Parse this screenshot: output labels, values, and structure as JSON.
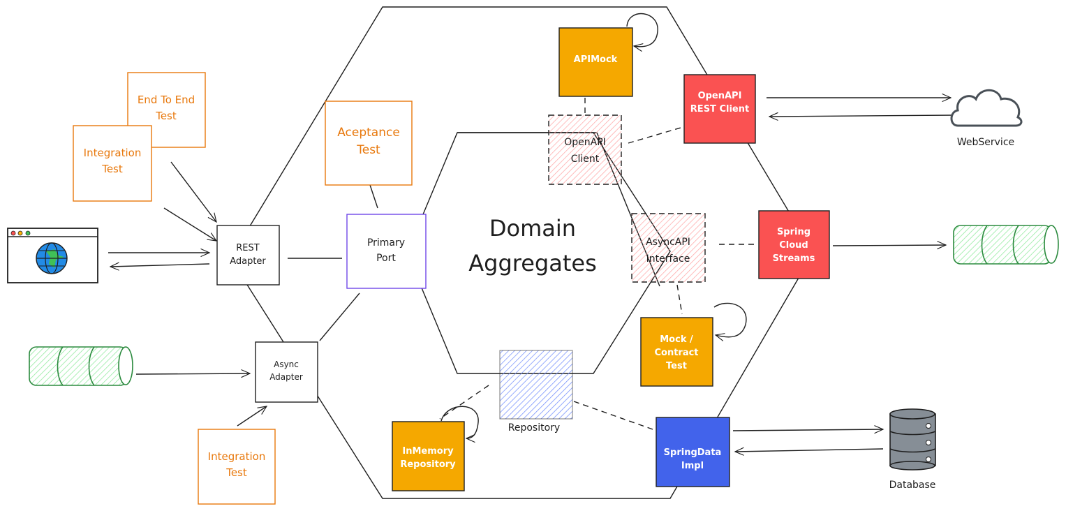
{
  "title": [
    "Domain",
    "Aggregates"
  ],
  "tests": {
    "end_to_end": [
      "End To End",
      "Test"
    ],
    "integration_top": [
      "Integration",
      "Test"
    ],
    "acceptance": [
      "Aceptance",
      "Test"
    ],
    "integration_bottom": [
      "Integration",
      "Test"
    ]
  },
  "adapters": {
    "rest": [
      "REST",
      "Adapter"
    ],
    "async": [
      "Async",
      "Adapter"
    ],
    "primary_port": [
      "Primary",
      "Port"
    ]
  },
  "nodes": {
    "apimock": "APIMock",
    "openapi_rest_client": [
      "OpenAPI",
      "REST Client"
    ],
    "openapi_client": [
      "OpenAPI",
      "Client"
    ],
    "asyncapi_interface": [
      "AsyncAPI",
      "Interface"
    ],
    "spring_cloud_streams": [
      "Spring",
      "Cloud",
      "Streams"
    ],
    "mock_contract_test": [
      "Mock /",
      "Contract",
      "Test"
    ],
    "repository": "Repository",
    "inmemory_repository": [
      "InMemory",
      "Repository"
    ],
    "springdata_impl": [
      "SpringData",
      "Impl"
    ],
    "webservice": "WebService",
    "database": "Database"
  },
  "icons": {
    "browser": "browser-globe-icon",
    "queue": "message-queue-icon",
    "cloud": "cloud-icon",
    "database": "database-icon"
  },
  "colors": {
    "orange": "#f5a800",
    "red": "#fa5252",
    "blue": "#4263eb",
    "purple": "#7048e8",
    "test_outline": "#e8780c",
    "queue_green": "#2b8a3e"
  }
}
